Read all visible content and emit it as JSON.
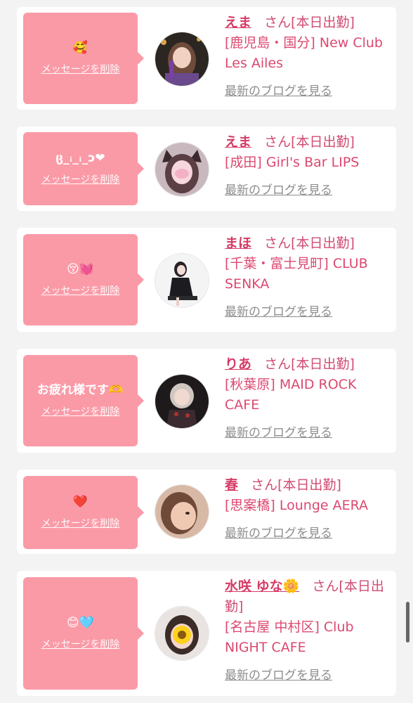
{
  "delete_label": "メッセージを削除",
  "blog_label": "最新のブログを見る",
  "san_label": "さん[本日出勤]",
  "colors": {
    "bubble": "#fb9aa7",
    "accent": "#d53b66",
    "link_gray": "#8d8d8d"
  },
  "cards": [
    {
      "message": "🥰",
      "name": "えま",
      "shop": "[鹿児島・国分] New Club Les Ailes",
      "avatar_icon": "woman-portrait-night"
    },
    {
      "message": "ც_ꜟ_ꜟ_ɔ❤",
      "name": "えま",
      "shop": "[成田] Girl's Bar LIPS",
      "avatar_icon": "woman-with-cat-ears"
    },
    {
      "message": "😚💓",
      "name": "まほ",
      "shop": "[千葉・富士見町] CLUB SENKA",
      "avatar_icon": "woman-seated-black-dress"
    },
    {
      "message": "お疲れ様です🫶",
      "name": "りあ",
      "shop": "[秋葉原] MAID ROCK CAFE",
      "avatar_icon": "woman-dark-outfit"
    },
    {
      "message": "❤️",
      "name": "春",
      "shop": "[思案橋] Lounge AERA",
      "avatar_icon": "woman-closeup"
    },
    {
      "message": "😊🩵",
      "name": "水咲 ゆな🌼",
      "shop": "[名古屋 中村区] Club NIGHT CAFE",
      "avatar_icon": "woman-sunflower-sticker"
    }
  ]
}
